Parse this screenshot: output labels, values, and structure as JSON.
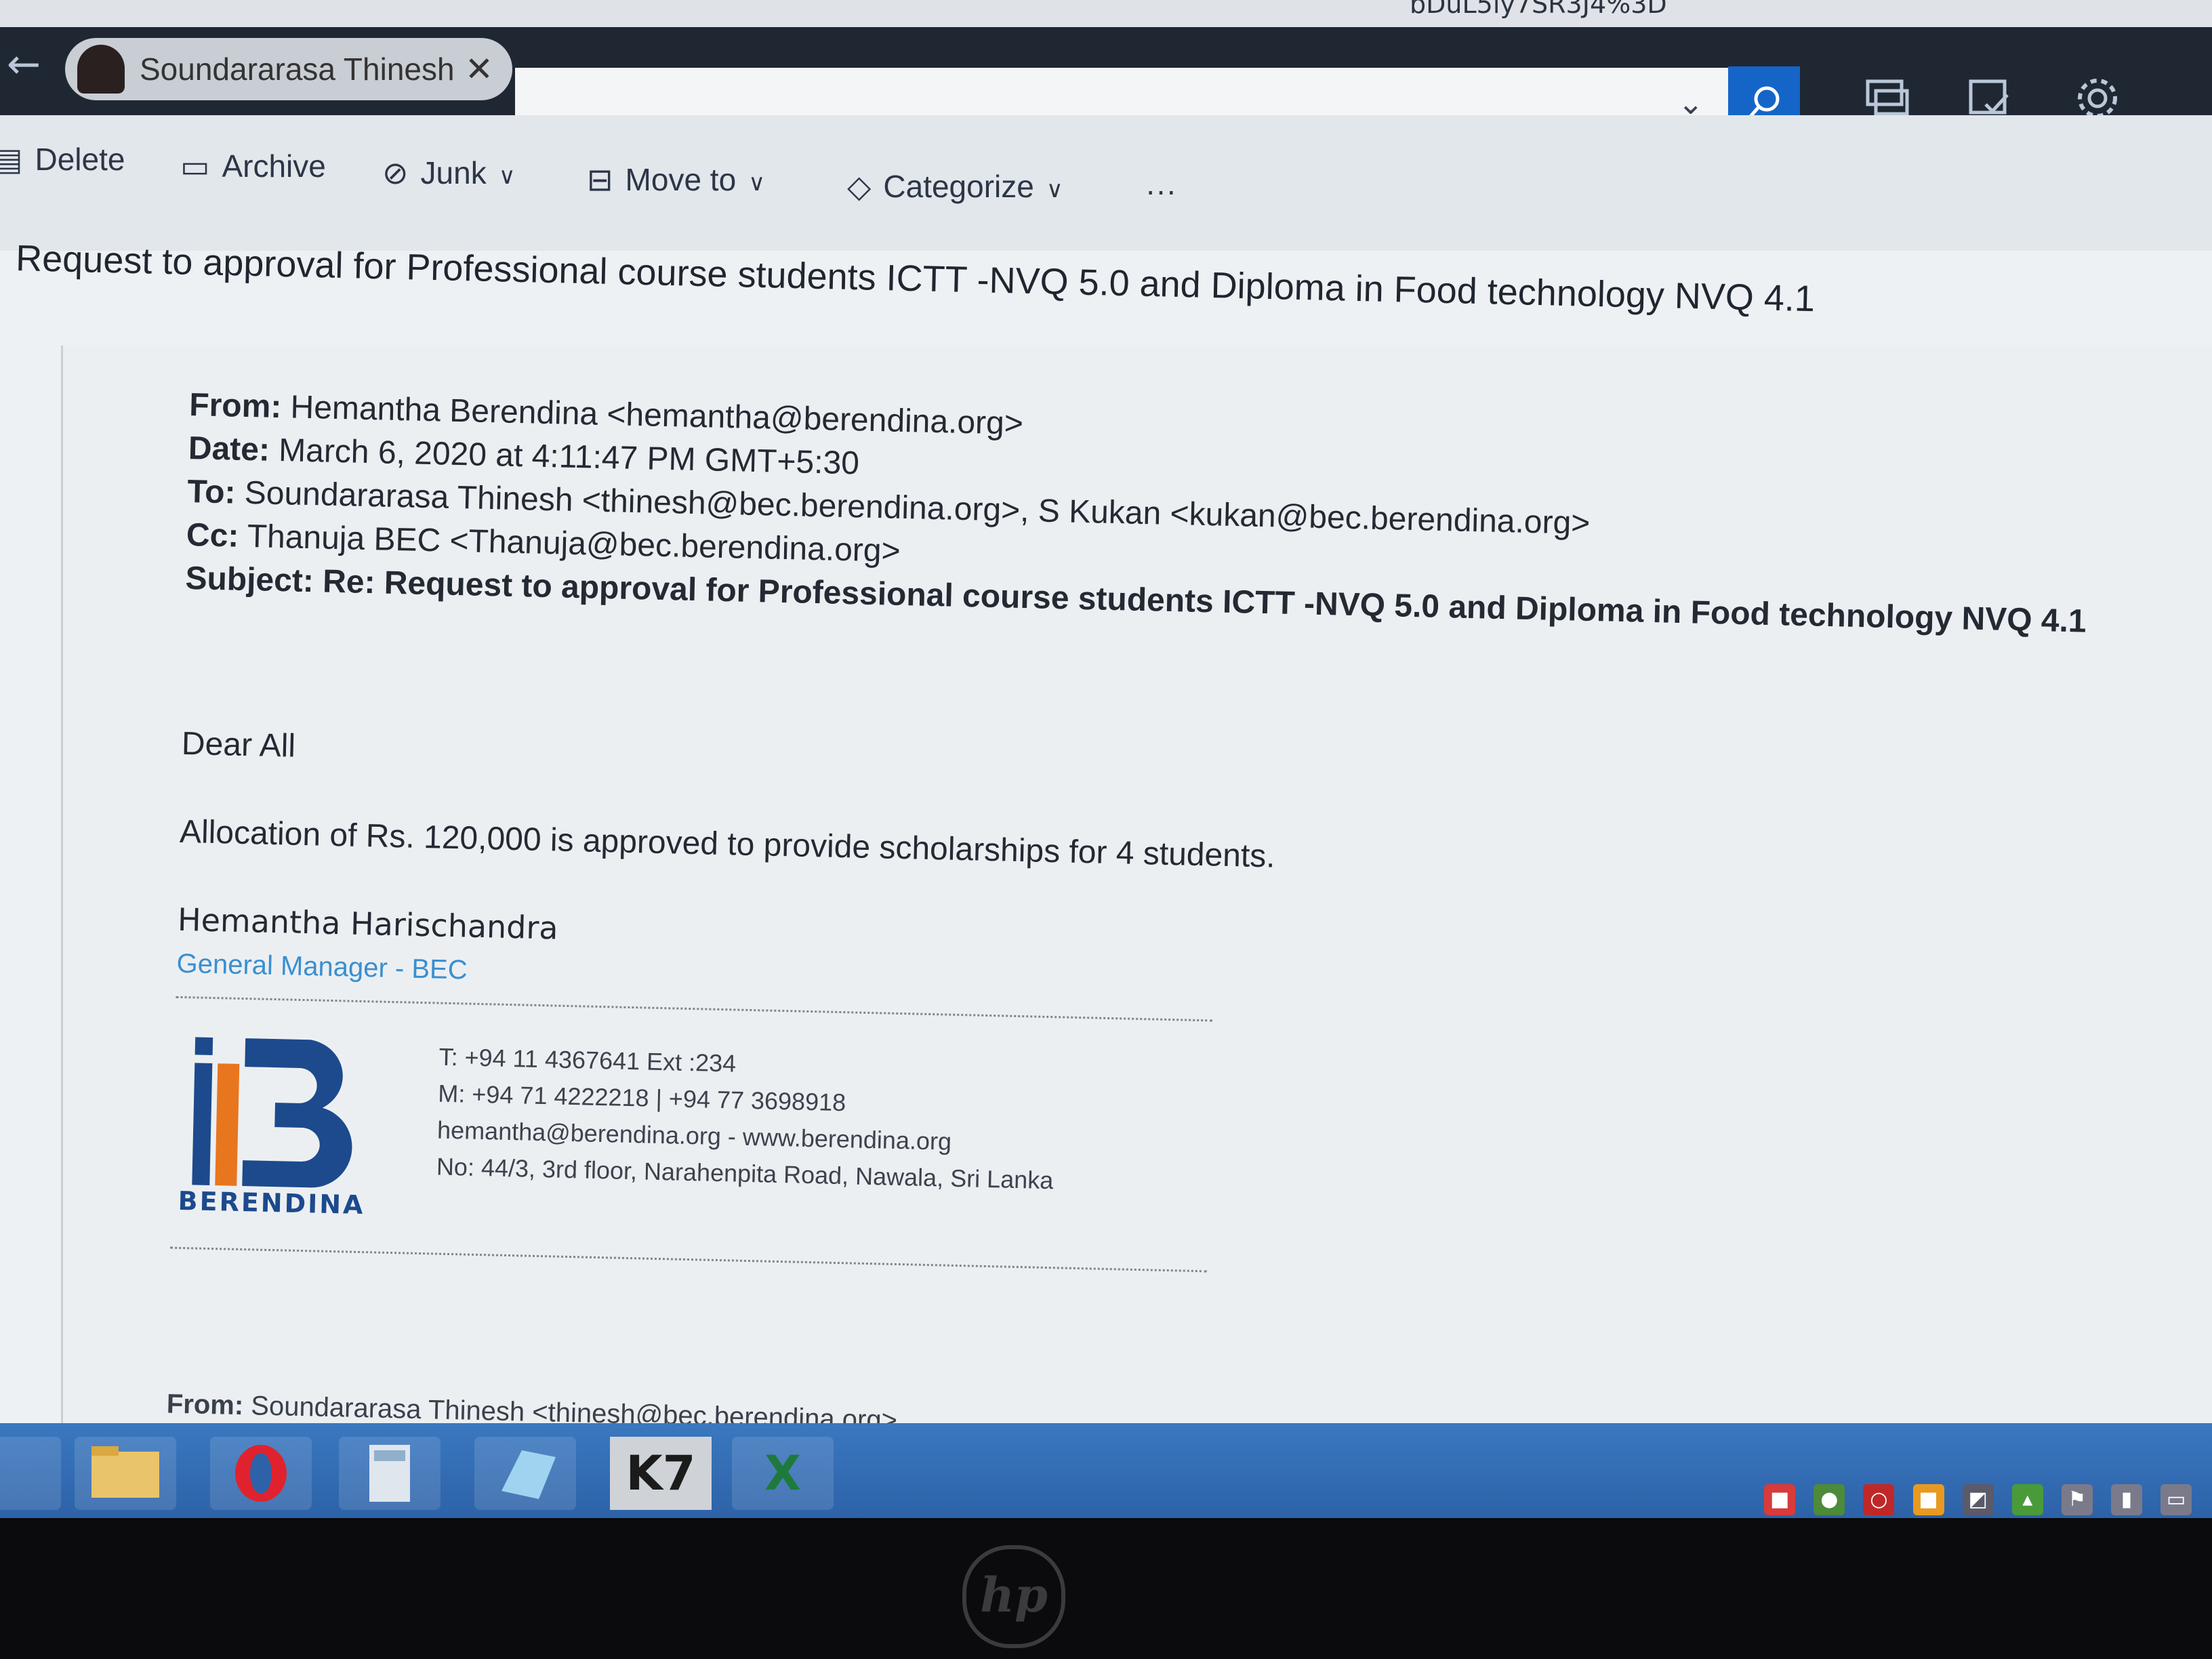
{
  "browser": {
    "url_fragment": "bDuL5ly7SR3J4%3D"
  },
  "header": {
    "back_glyph": "←",
    "person_tab": {
      "name": "Soundararasa Thinesh",
      "close_glyph": "✕"
    },
    "search": {
      "dropdown_glyph": "⌄",
      "button_glyph": "⌕"
    },
    "icons": [
      "chat-icon",
      "tasks-icon",
      "settings-icon"
    ]
  },
  "toolbar": {
    "delete_label": "Delete",
    "archive_label": "Archive",
    "junk_label": "Junk",
    "move_to_label": "Move to",
    "categorize_label": "Categorize",
    "more_label": "···"
  },
  "message": {
    "subject": "Request to approval for Professional course students ICTT -NVQ 5.0 and Diploma in Food technology NVQ 4.1",
    "headers": {
      "from_label": "From:",
      "from_value": " Hemantha Berendina <hemantha@berendina.org>",
      "date_label": "Date:",
      "date_value": " March 6, 2020 at 4:11:47 PM GMT+5:30",
      "to_label": "To:",
      "to_value": " Soundararasa Thinesh <thinesh@bec.berendina.org>, S Kukan <kukan@bec.berendina.org>",
      "cc_label": "Cc:",
      "cc_value": " Thanuja BEC <Thanuja@bec.berendina.org>",
      "subject_label": "Subject: Re:",
      "subject_value": "  Request to approval for Professional course students ICTT -NVQ 5.0 and Diploma in Food technology NVQ 4.1"
    },
    "greeting": "Dear All",
    "body": "Allocation of Rs. 120,000 is approved to provide scholarships for 4 students.",
    "signature": {
      "name": "Hemantha Harischandra",
      "role": "General Manager - BEC",
      "logo_word": "BERENDINA",
      "phone": "T: +94 11 4367641 Ext :234",
      "mobile": "M: +94 71 4222218 | +94 77 3698918",
      "web": "hemantha@berendina.org - www.berendina.org",
      "address": "No: 44/3, 3rd floor, Narahenpita Road, Nawala, Sri Lanka"
    },
    "quoted": {
      "from_label": "From:",
      "from_value": " Soundararasa Thinesh <thinesh@bec.berendina.org>"
    }
  },
  "taskbar": {
    "apps": [
      "file-explorer",
      "opera",
      "calculator",
      "notes",
      "k7-antivirus",
      "excel"
    ],
    "k7_label": "K7",
    "excel_label": "X"
  },
  "bezel": {
    "brand": "hp"
  },
  "colors": {
    "header_bg": "#1f2733",
    "search_button": "#1565c8",
    "signature_role": "#3a8fd0",
    "logo_blue": "#1c4a8c",
    "logo_orange": "#e8761f",
    "taskbar": "#2d62a8"
  }
}
